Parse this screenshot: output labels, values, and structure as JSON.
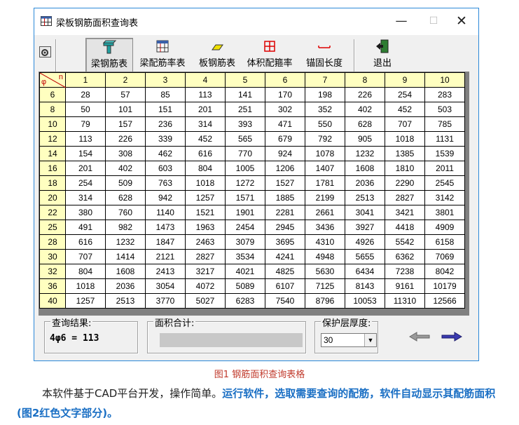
{
  "window": {
    "title": "梁板钢筋面积查询表"
  },
  "toolbar": {
    "buttons": [
      {
        "label": "梁钢筋表",
        "icon": "beam-rebar-icon"
      },
      {
        "label": "梁配筋率表",
        "icon": "table-icon"
      },
      {
        "label": "板钢筋表",
        "icon": "slab-icon"
      },
      {
        "label": "体积配箍率",
        "icon": "stirrup-grid-icon"
      },
      {
        "label": "锚固长度",
        "icon": "anchor-length-icon"
      },
      {
        "label": "退出",
        "icon": "exit-door-icon"
      }
    ]
  },
  "grid": {
    "corner": {
      "phi": "φ",
      "n": "n"
    },
    "columns": [
      "1",
      "2",
      "3",
      "4",
      "5",
      "6",
      "7",
      "8",
      "9",
      "10"
    ],
    "rows": [
      {
        "d": "6",
        "v": [
          "28",
          "57",
          "85",
          "113",
          "141",
          "170",
          "198",
          "226",
          "254",
          "283"
        ]
      },
      {
        "d": "8",
        "v": [
          "50",
          "101",
          "151",
          "201",
          "251",
          "302",
          "352",
          "402",
          "452",
          "503"
        ]
      },
      {
        "d": "10",
        "v": [
          "79",
          "157",
          "236",
          "314",
          "393",
          "471",
          "550",
          "628",
          "707",
          "785"
        ]
      },
      {
        "d": "12",
        "v": [
          "113",
          "226",
          "339",
          "452",
          "565",
          "679",
          "792",
          "905",
          "1018",
          "1131"
        ]
      },
      {
        "d": "14",
        "v": [
          "154",
          "308",
          "462",
          "616",
          "770",
          "924",
          "1078",
          "1232",
          "1385",
          "1539"
        ]
      },
      {
        "d": "16",
        "v": [
          "201",
          "402",
          "603",
          "804",
          "1005",
          "1206",
          "1407",
          "1608",
          "1810",
          "2011"
        ]
      },
      {
        "d": "18",
        "v": [
          "254",
          "509",
          "763",
          "1018",
          "1272",
          "1527",
          "1781",
          "2036",
          "2290",
          "2545"
        ]
      },
      {
        "d": "20",
        "v": [
          "314",
          "628",
          "942",
          "1257",
          "1571",
          "1885",
          "2199",
          "2513",
          "2827",
          "3142"
        ]
      },
      {
        "d": "22",
        "v": [
          "380",
          "760",
          "1140",
          "1521",
          "1901",
          "2281",
          "2661",
          "3041",
          "3421",
          "3801"
        ]
      },
      {
        "d": "25",
        "v": [
          "491",
          "982",
          "1473",
          "1963",
          "2454",
          "2945",
          "3436",
          "3927",
          "4418",
          "4909"
        ]
      },
      {
        "d": "28",
        "v": [
          "616",
          "1232",
          "1847",
          "2463",
          "3079",
          "3695",
          "4310",
          "4926",
          "5542",
          "6158"
        ]
      },
      {
        "d": "30",
        "v": [
          "707",
          "1414",
          "2121",
          "2827",
          "3534",
          "4241",
          "4948",
          "5655",
          "6362",
          "7069"
        ]
      },
      {
        "d": "32",
        "v": [
          "804",
          "1608",
          "2413",
          "3217",
          "4021",
          "4825",
          "5630",
          "6434",
          "7238",
          "8042"
        ]
      },
      {
        "d": "36",
        "v": [
          "1018",
          "2036",
          "3054",
          "4072",
          "5089",
          "6107",
          "7125",
          "8143",
          "9161",
          "10179"
        ]
      },
      {
        "d": "40",
        "v": [
          "1257",
          "2513",
          "3770",
          "5027",
          "6283",
          "7540",
          "8796",
          "10053",
          "11310",
          "12566"
        ]
      }
    ]
  },
  "result": {
    "label": "查询结果:",
    "value": "4φ6 = 113"
  },
  "area_total": {
    "label": "面积合计:",
    "value": ""
  },
  "cover": {
    "label": "保护层厚度:",
    "selected": "30"
  },
  "caption": "图1  钢筋面积查询表格",
  "paragraph": {
    "plain": "本软件基于CAD平台开发，操作简单。",
    "highlight": "运行软件，选取需要查询的配筋，软件自动显示其配筋面积(图2红色文字部分)。"
  },
  "colors": {
    "header_fill": "#ffffc0",
    "caption": "#c0392b",
    "highlight": "#1a6fc4",
    "window_border": "#2b88d8"
  }
}
